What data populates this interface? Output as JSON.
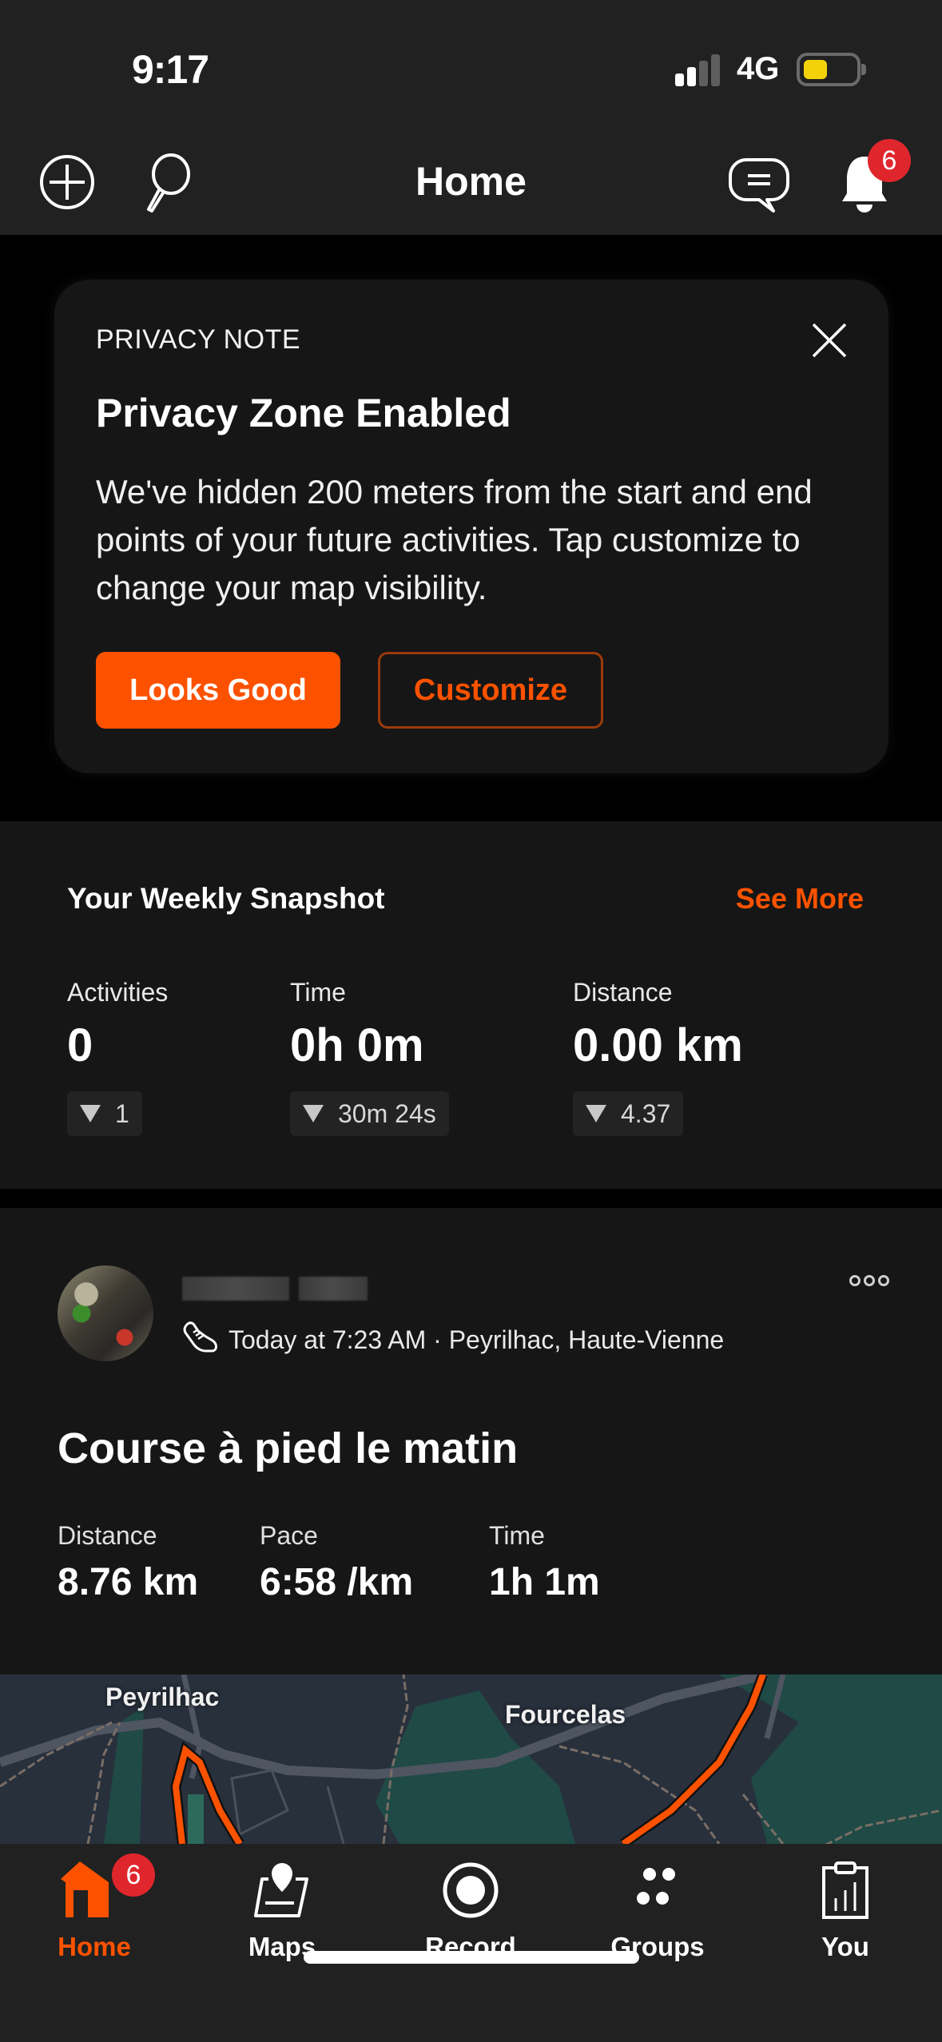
{
  "status_bar": {
    "time": "9:17",
    "network": "4G",
    "signal_bars_active": 2,
    "signal_bars_total": 4,
    "battery_level": 0.45,
    "battery_color": "#f3d20a"
  },
  "header": {
    "title": "Home",
    "left_icons": [
      "add-icon",
      "search-icon"
    ],
    "right_icons": [
      "chat-icon",
      "bell-icon"
    ],
    "notification_count": "6"
  },
  "privacy_card": {
    "eyebrow": "PRIVACY NOTE",
    "title": "Privacy Zone Enabled",
    "body": "We've hidden 200 meters from the start and end points of your future activities. Tap customize to change your map visibility.",
    "primary_button": "Looks Good",
    "secondary_button": "Customize"
  },
  "weekly_snapshot": {
    "title": "Your Weekly Snapshot",
    "see_more": "See More",
    "stats": [
      {
        "label": "Activities",
        "value": "0",
        "delta": "1",
        "delta_direction": "down"
      },
      {
        "label": "Time",
        "value": "0h 0m",
        "delta": "30m 24s",
        "delta_direction": "down"
      },
      {
        "label": "Distance",
        "value": "0.00 km",
        "delta": "4.37",
        "delta_direction": "down"
      }
    ]
  },
  "activity": {
    "athlete_name": "",
    "sport_icon": "running-shoe-icon",
    "meta": "Today at 7:23 AM · Peyrilhac, Haute-Vienne",
    "title": "Course à pied le matin",
    "stats": [
      {
        "label": "Distance",
        "value": "8.76 km"
      },
      {
        "label": "Pace",
        "value": "6:58 /km"
      },
      {
        "label": "Time",
        "value": "1h 1m"
      }
    ],
    "map_labels": [
      "Peyrilhac",
      "Fourcelas"
    ]
  },
  "tab_bar": {
    "items": [
      {
        "label": "Home",
        "icon": "home-icon",
        "active": true,
        "badge": "6"
      },
      {
        "label": "Maps",
        "icon": "map-pin-icon",
        "active": false
      },
      {
        "label": "Record",
        "icon": "record-icon",
        "active": false
      },
      {
        "label": "Groups",
        "icon": "groups-icon",
        "active": false
      },
      {
        "label": "You",
        "icon": "clipboard-chart-icon",
        "active": false
      }
    ]
  },
  "colors": {
    "accent": "#fc5200",
    "badge": "#e0262d",
    "background": "#000000",
    "surface": "#161616",
    "bar": "#212121"
  }
}
